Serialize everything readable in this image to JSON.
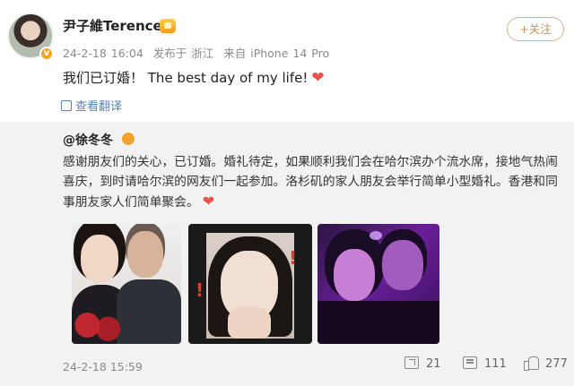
{
  "post": {
    "author": "尹子維Terence",
    "avatar_badge_icon": "v-verified-icon",
    "timestamp": "24-2-18 16:04",
    "location": "发布于 浙江",
    "source": "来自 iPhone 14 Pro",
    "text": "我们已订婚！ The best day of my life!",
    "heart": "❤",
    "follow_label": "+关注",
    "translate_label": "查看翻译"
  },
  "repost": {
    "author": "@徐冬冬",
    "text": "感谢朋友们的关心，已订婚。婚礼待定，如果顺利我们会在哈尔滨办个流水席，接地气热闹喜庆，到时请哈尔滨的网友们一起参加。洛杉矶的家人朋友会举行简单小型婚礼。香港和同事朋友家人们简单聚会。",
    "heart": "❤",
    "timestamp": "24-2-18 15:59",
    "photos": [
      {
        "icon": "couple-photo"
      },
      {
        "icon": "selfie-photo"
      },
      {
        "icon": "purple-light-photo"
      }
    ],
    "actions": {
      "repost_count": "21",
      "comment_count": "111",
      "like_count": "277"
    }
  },
  "colors": {
    "accent_gold": "#d7b48a",
    "link_blue": "#5c7fb3",
    "heart_red": "#e8534e",
    "repost_bg": "#f2f2f2"
  }
}
